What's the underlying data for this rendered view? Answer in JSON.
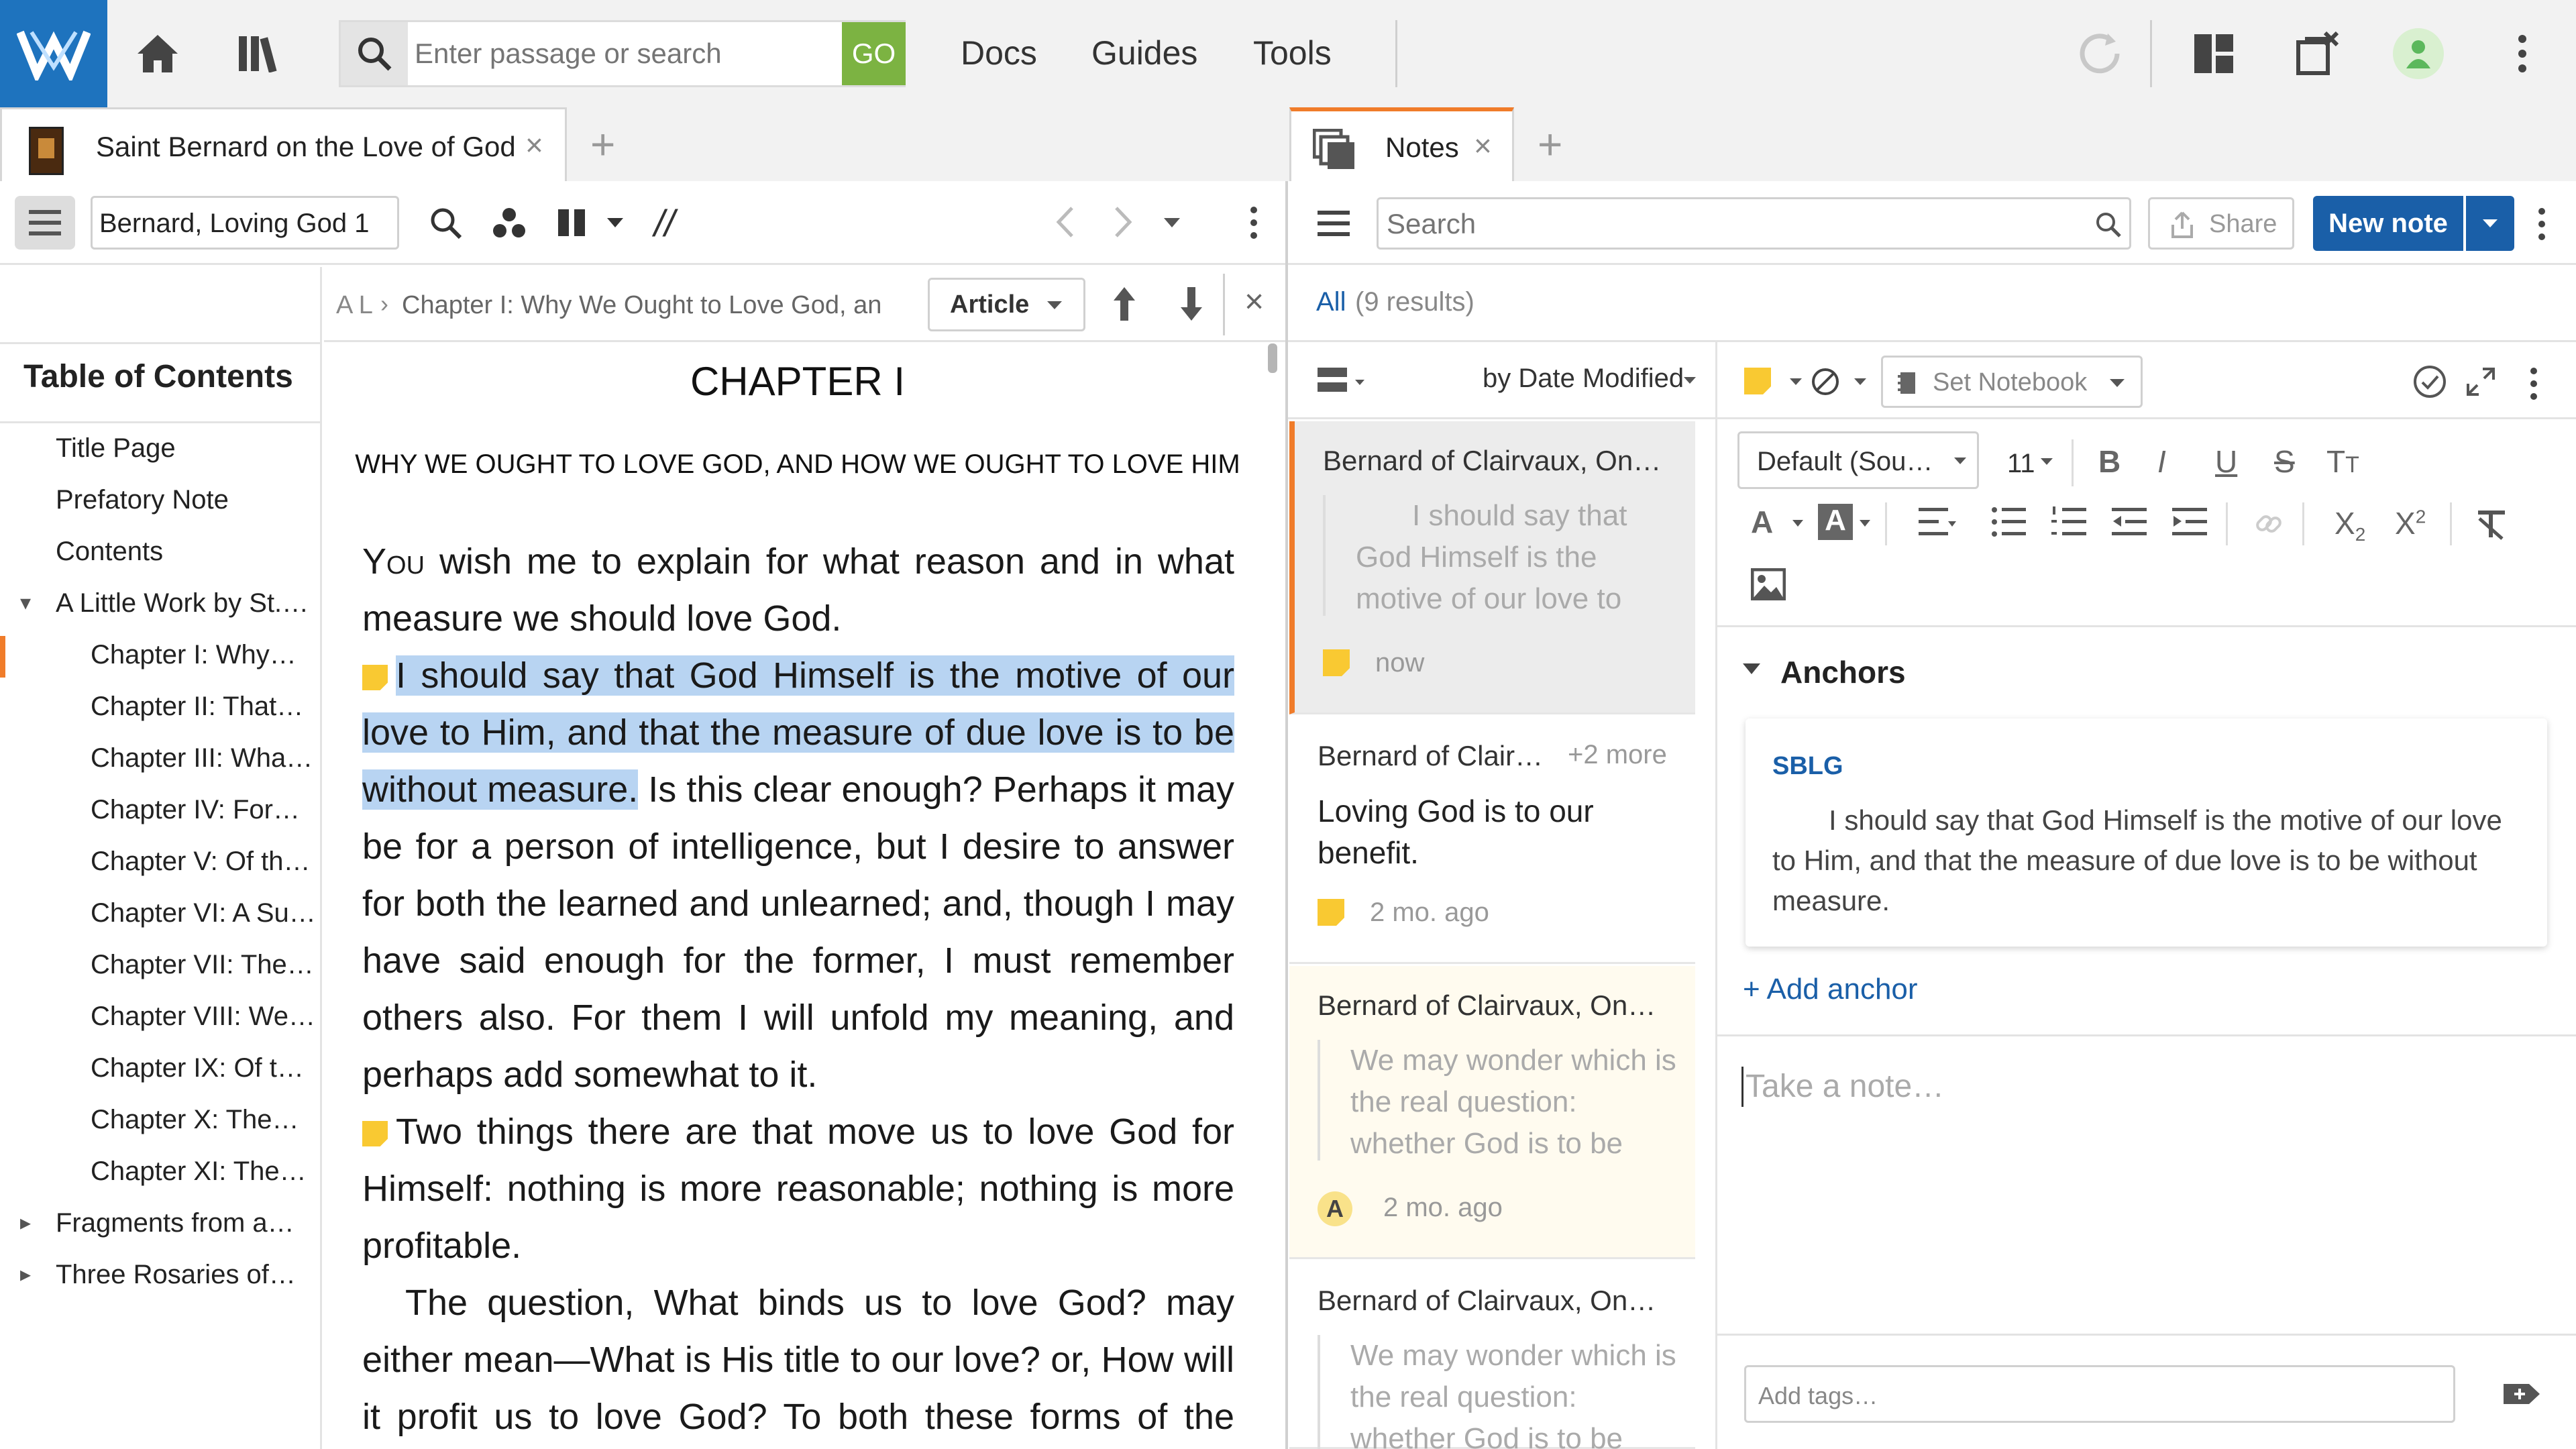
{
  "topbar": {
    "search_placeholder": "Enter passage or search",
    "go_label": "GO",
    "nav": [
      "Docs",
      "Guides",
      "Tools"
    ]
  },
  "left_tab": {
    "title": "Saint Bernard on the Love of God",
    "close": "×",
    "plus": "+"
  },
  "right_tab": {
    "title": "Notes",
    "close": "×",
    "plus": "+"
  },
  "reader_toolbar": {
    "reference": "Bernard, Loving God 1",
    "parallel": "//"
  },
  "reader_nav": {
    "breadcrumb_start": "A L",
    "breadcrumb": "Chapter I: Why We Ought to Love God, an",
    "article_label": "Article",
    "close": "×"
  },
  "toc": {
    "heading": "Table of Contents",
    "items": [
      {
        "label": "Title Page",
        "level": 0
      },
      {
        "label": "Prefatory Note",
        "level": 0
      },
      {
        "label": "Contents",
        "level": 0
      },
      {
        "label": "A Little Work by St.…",
        "level": 0,
        "toggle": "▾"
      },
      {
        "label": "Chapter I: Why…",
        "level": 1,
        "active": true
      },
      {
        "label": "Chapter II: That…",
        "level": 1
      },
      {
        "label": "Chapter III: Wha…",
        "level": 1
      },
      {
        "label": "Chapter IV: For…",
        "level": 1
      },
      {
        "label": "Chapter V: Of th…",
        "level": 1
      },
      {
        "label": "Chapter VI: A Su…",
        "level": 1
      },
      {
        "label": "Chapter VII: The…",
        "level": 1
      },
      {
        "label": "Chapter VIII: We…",
        "level": 1
      },
      {
        "label": "Chapter IX: Of t…",
        "level": 1
      },
      {
        "label": "Chapter X: The…",
        "level": 1
      },
      {
        "label": "Chapter XI: The…",
        "level": 1
      },
      {
        "label": "Fragments from a…",
        "level": 0,
        "toggle": "▸"
      },
      {
        "label": "Three Rosaries of…",
        "level": 0,
        "toggle": "▸"
      }
    ]
  },
  "reader": {
    "chapter_title": "CHAPTER I",
    "subtitle": "WHY WE OUGHT TO LOVE GOD, AND HOW WE OUGHT TO LOVE HIM",
    "p1_dropcap": "You",
    "p1": " wish me to explain for what reason and in what measure we should love God.",
    "p2_highlight": "I should say that God Himself is the motive of our love to Him, and that the measure of due love is to be without measure.",
    "p2_rest": " Is this clear enough? Perhaps it may be for a person of intelligence, but I desire to answer for both the learned and unlearned; and, though I may have said enough for the former, I must remember others also. For them I will unfold my meaning, and perhaps add somewhat to it.",
    "p3": "Two things there are that move us to love God for Himself: nothing is more reasonable; nothing is more profitable.",
    "p4": "The question, What binds us to love God? may either mean—What is His title to our love? or, How will it profit us to love God? To both these forms of the question I answer."
  },
  "notes_toolbar": {
    "search_placeholder": "Search",
    "share_label": "Share",
    "new_note_label": "New note"
  },
  "notes_filter": {
    "all_label": "All",
    "results": "(9 results)",
    "sort_label": "by Date Modified"
  },
  "notes_list": [
    {
      "title": "Bernard of Clairvaux, On…",
      "quote": "I should say that God Himself is the motive of our love to",
      "time": "now",
      "badge": "sticky",
      "selected": true
    },
    {
      "title": "Bernard of Clair…",
      "more": "+2 more",
      "body": "Loving God is to our benefit.",
      "time": "2 mo. ago",
      "badge": "sticky"
    },
    {
      "title": "Bernard of Clairvaux, On…",
      "quote": "We may wonder which is the real question: whether God is to be",
      "time": "2 mo. ago",
      "badge": "A"
    },
    {
      "title": "Bernard of Clairvaux, On…",
      "quote": "We may wonder which is the real question: whether God is to be",
      "time": "",
      "badge": ""
    }
  ],
  "editor": {
    "set_notebook": "Set Notebook",
    "font_family": "Default (Sou…",
    "font_size": "11",
    "anchors_heading": "Anchors",
    "anchor_source": "SBLG",
    "anchor_text": "I should say that God Himself is the motive of our love to Him, and that the measure of due love is to be without measure.",
    "add_anchor": "+ Add anchor",
    "note_placeholder": "Take a note…",
    "tags_placeholder": "Add tags…"
  },
  "colors": {
    "brand_blue": "#1e73be",
    "go_green": "#7cb342",
    "highlight": "#b8d4f2",
    "sticky": "#f9c932",
    "accent_orange": "#f07c2a",
    "link_blue": "#1a5fa8"
  }
}
